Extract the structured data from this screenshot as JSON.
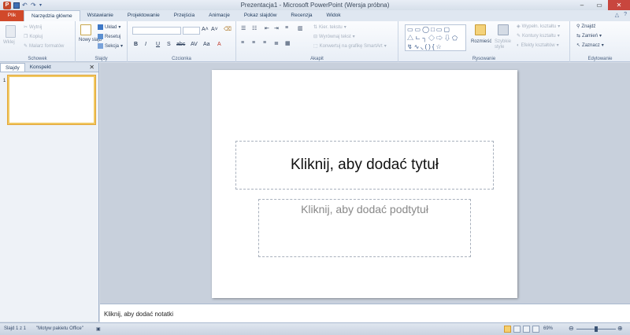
{
  "window": {
    "title": "Prezentacja1 - Microsoft PowerPoint (Wersja próbna)"
  },
  "qat": {
    "logo": "P"
  },
  "tabs": [
    "Plik",
    "Narzędzia główne",
    "Wstawianie",
    "Projektowanie",
    "Przejścia",
    "Animacje",
    "Pokaz slajdów",
    "Recenzja",
    "Widok"
  ],
  "ribbon": {
    "clipboard": {
      "label": "Schowek",
      "paste": "Wklej",
      "cut": "Wytnij",
      "copy": "Kopiuj",
      "painter": "Malarz formatów"
    },
    "slides": {
      "label": "Slajdy",
      "new_slide": "Nowy slajd",
      "layout": "Układ",
      "reset": "Resetuj",
      "section": "Sekcja"
    },
    "font": {
      "label": "Czcionka"
    },
    "paragraph": {
      "label": "Akapit",
      "text_dir": "Kier. tekstu",
      "align_text": "Wyrównaj tekst",
      "smartart": "Konwertuj na grafikę SmartArt"
    },
    "drawing": {
      "label": "Rysowanie",
      "arrange": "Rozmieść",
      "quick_styles": "Szybkie style",
      "fill": "Wypełn. kształtu",
      "outline": "Kontury kształtu",
      "effects": "Efekty kształtów"
    },
    "editing": {
      "label": "Edytowanie",
      "find": "Znajdź",
      "replace": "Zamień",
      "select": "Zaznacz"
    }
  },
  "panel": {
    "tab_slides": "Slajdy",
    "tab_outline": "Konspekt",
    "slide_number": "1"
  },
  "slide": {
    "title_placeholder": "Kliknij, aby dodać tytuł",
    "subtitle_placeholder": "Kliknij, aby dodać podtytuł"
  },
  "notes": {
    "placeholder": "Kliknij, aby dodać notatki"
  },
  "status": {
    "slide_info": "Slajd 1 z 1",
    "theme": "\"Motyw pakietu Office\"",
    "zoom": "69%"
  },
  "colors": {
    "file_tab": "#d1492a",
    "ribbon": "#e8eef6",
    "accent_selection": "#f0c862"
  }
}
